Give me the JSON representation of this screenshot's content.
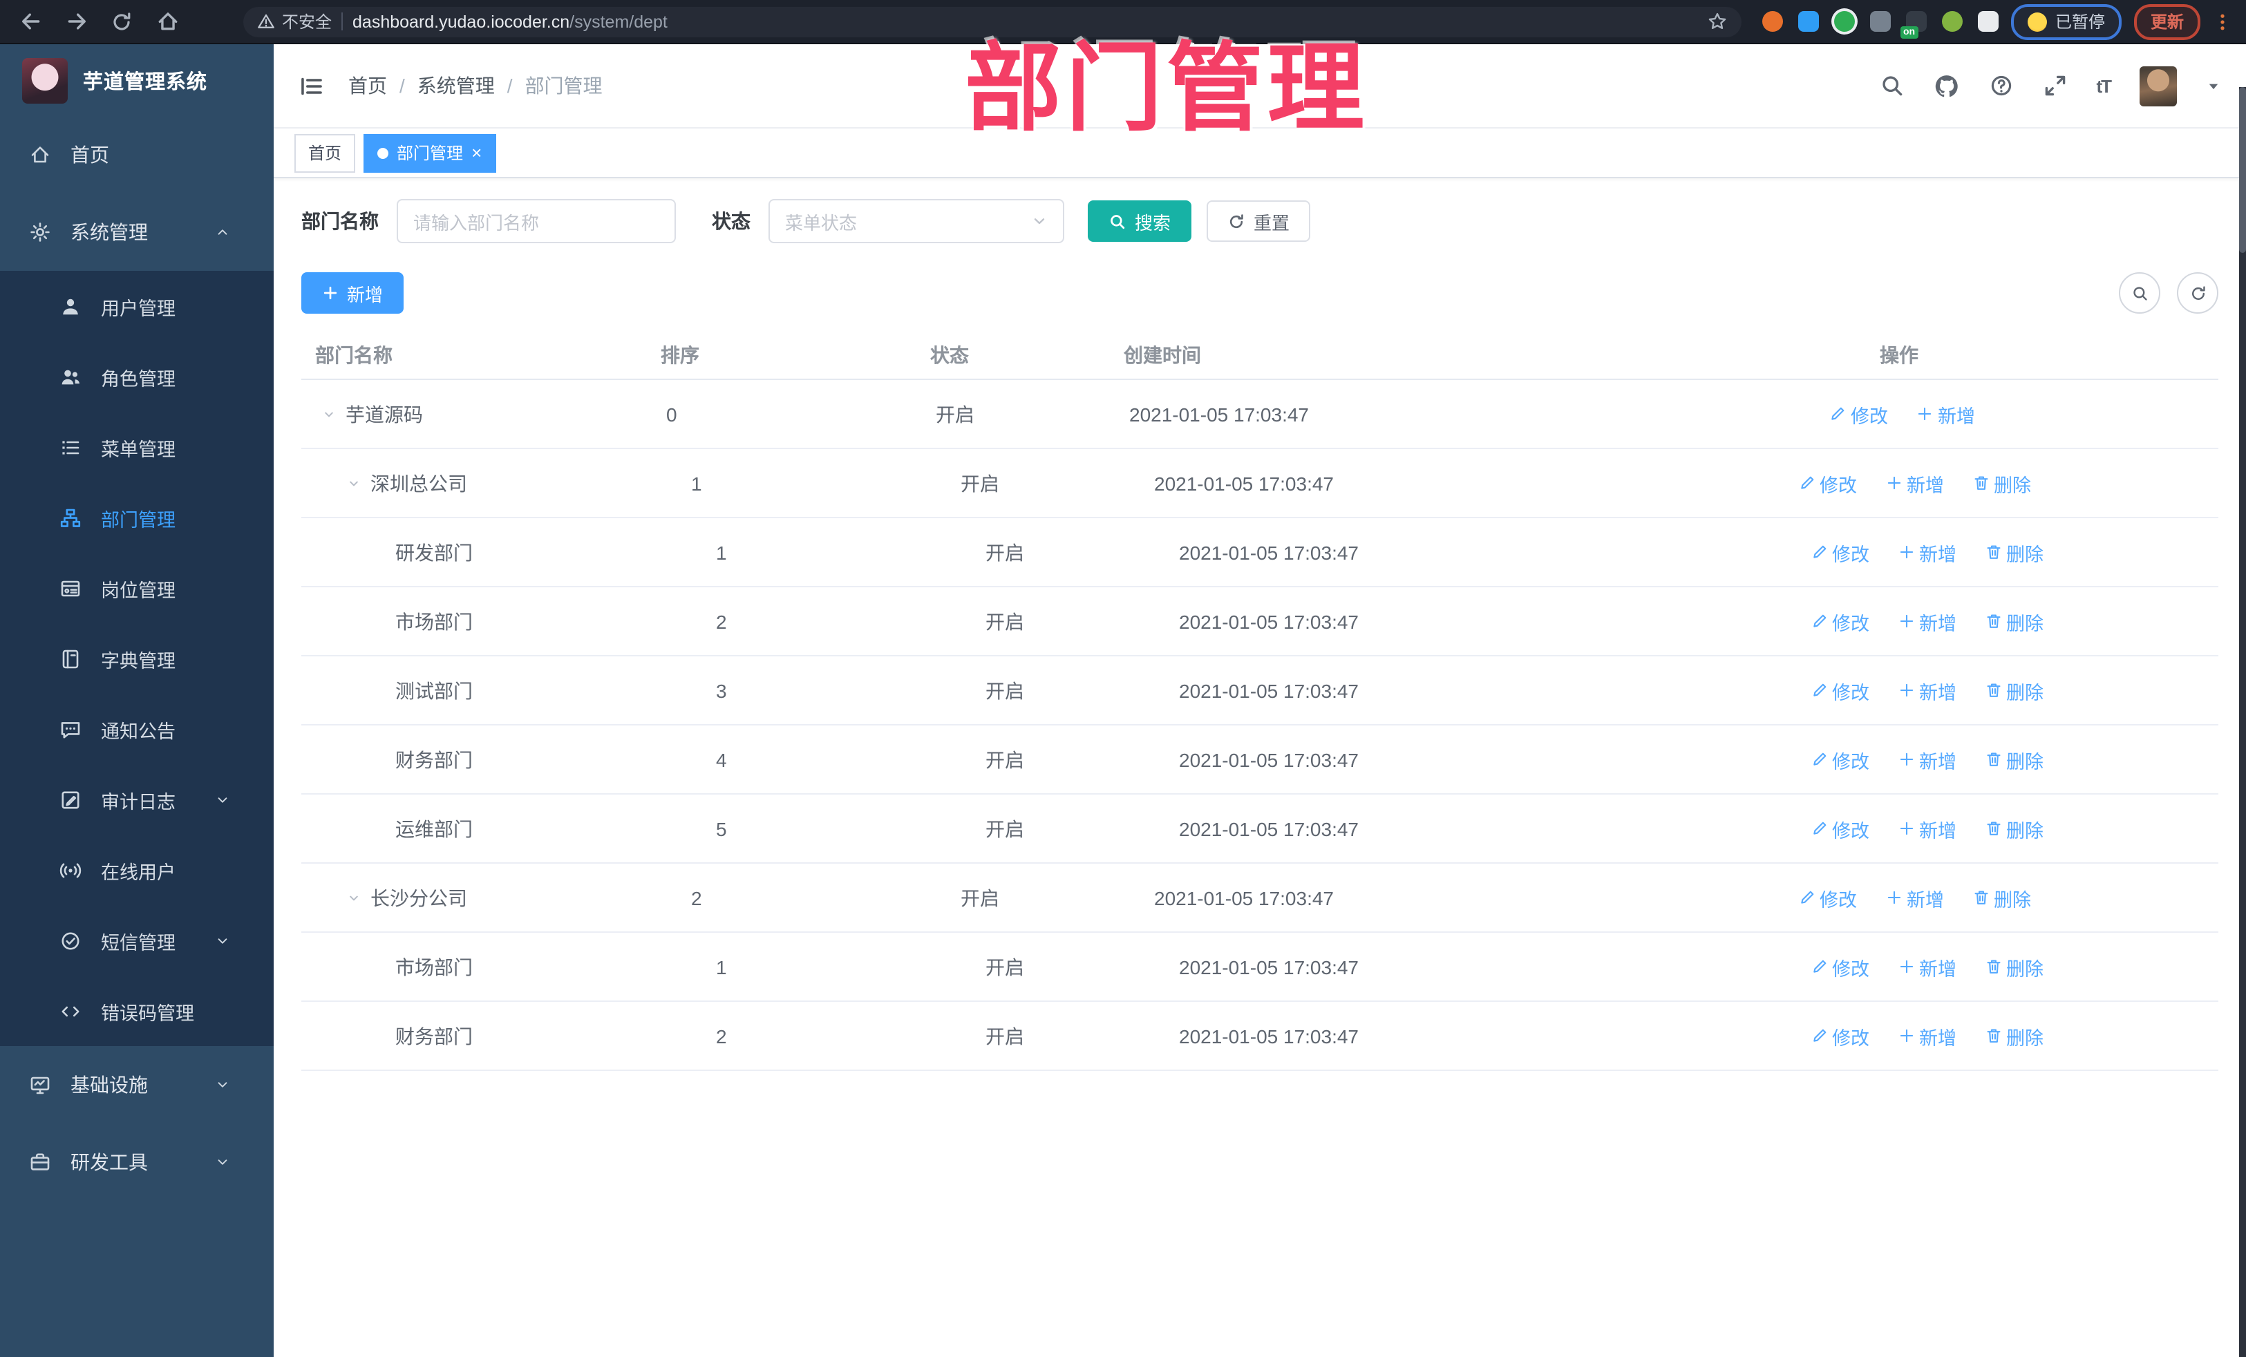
{
  "annotation": {
    "title": "部门管理",
    "color": "#f43f66"
  },
  "browser": {
    "security_label": "不安全",
    "url_host": "dashboard.yudao.iocoder.cn",
    "url_path": "/system/dept",
    "paused_label": "已暂停",
    "update_label": "更新",
    "extensions": [
      {
        "name": "extension-orange-icon",
        "color": "#e8702c",
        "shape": "circle"
      },
      {
        "name": "extension-location-icon",
        "color": "#2f9df4",
        "shape": "drop"
      },
      {
        "name": "extension-green-check-icon",
        "color": "#2fae54",
        "shape": "circle",
        "ring": "#e9ecef"
      },
      {
        "name": "extension-grid-icon",
        "color": "#77828f",
        "shape": "square"
      },
      {
        "name": "extension-adblock-icon",
        "color": "#343b45",
        "shape": "square",
        "badge": "on",
        "badge_color": "#23a455"
      },
      {
        "name": "extension-green-figure-icon",
        "color": "#83b441",
        "shape": "circle"
      },
      {
        "name": "extension-puzzle-icon",
        "color": "#e9ebee",
        "shape": "square"
      }
    ]
  },
  "sidebar": {
    "app_title": "芋道管理系统",
    "items": [
      {
        "label": "首页",
        "icon": "home-icon",
        "level": "top"
      },
      {
        "label": "系统管理",
        "icon": "gear-icon",
        "level": "top",
        "chevron": "up"
      },
      {
        "label": "用户管理",
        "icon": "user-icon",
        "level": "sub"
      },
      {
        "label": "角色管理",
        "icon": "users-icon",
        "level": "sub"
      },
      {
        "label": "菜单管理",
        "icon": "menu-list-icon",
        "level": "sub"
      },
      {
        "label": "部门管理",
        "icon": "org-tree-icon",
        "level": "sub",
        "active": true
      },
      {
        "label": "岗位管理",
        "icon": "id-badge-icon",
        "level": "sub"
      },
      {
        "label": "字典管理",
        "icon": "dictionary-icon",
        "level": "sub"
      },
      {
        "label": "通知公告",
        "icon": "announcement-icon",
        "level": "sub"
      },
      {
        "label": "审计日志",
        "icon": "audit-log-icon",
        "level": "sub",
        "chevron": "down"
      },
      {
        "label": "在线用户",
        "icon": "online-users-icon",
        "level": "sub"
      },
      {
        "label": "短信管理",
        "icon": "sms-icon",
        "level": "sub",
        "chevron": "down"
      },
      {
        "label": "错误码管理",
        "icon": "error-code-icon",
        "level": "sub"
      },
      {
        "label": "基础设施",
        "icon": "infrastructure-icon",
        "level": "top",
        "chevron": "down"
      },
      {
        "label": "研发工具",
        "icon": "dev-tools-icon",
        "level": "top",
        "chevron": "down"
      }
    ]
  },
  "navbar": {
    "breadcrumb": [
      "首页",
      "系统管理",
      "部门管理"
    ]
  },
  "tabs": [
    {
      "label": "首页",
      "active": false
    },
    {
      "label": "部门管理",
      "active": true,
      "closable": true
    }
  ],
  "filters": {
    "name_label": "部门名称",
    "name_placeholder": "请输入部门名称",
    "status_label": "状态",
    "status_placeholder": "菜单状态",
    "search_label": "搜索",
    "reset_label": "重置"
  },
  "toolbar": {
    "add_label": "新增"
  },
  "table": {
    "columns": [
      "部门名称",
      "排序",
      "状态",
      "创建时间",
      "操作"
    ],
    "action_labels": {
      "edit": "修改",
      "add": "新增",
      "delete": "删除"
    },
    "rows": [
      {
        "name": "芋道源码",
        "level": 0,
        "expandable": true,
        "sort": "0",
        "status": "开启",
        "created": "2021-01-05 17:03:47",
        "actions": [
          "edit",
          "add"
        ]
      },
      {
        "name": "深圳总公司",
        "level": 1,
        "expandable": true,
        "sort": "1",
        "status": "开启",
        "created": "2021-01-05 17:03:47",
        "actions": [
          "edit",
          "add",
          "delete"
        ]
      },
      {
        "name": "研发部门",
        "level": 2,
        "expandable": false,
        "sort": "1",
        "status": "开启",
        "created": "2021-01-05 17:03:47",
        "actions": [
          "edit",
          "add",
          "delete"
        ]
      },
      {
        "name": "市场部门",
        "level": 2,
        "expandable": false,
        "sort": "2",
        "status": "开启",
        "created": "2021-01-05 17:03:47",
        "actions": [
          "edit",
          "add",
          "delete"
        ]
      },
      {
        "name": "测试部门",
        "level": 2,
        "expandable": false,
        "sort": "3",
        "status": "开启",
        "created": "2021-01-05 17:03:47",
        "actions": [
          "edit",
          "add",
          "delete"
        ]
      },
      {
        "name": "财务部门",
        "level": 2,
        "expandable": false,
        "sort": "4",
        "status": "开启",
        "created": "2021-01-05 17:03:47",
        "actions": [
          "edit",
          "add",
          "delete"
        ]
      },
      {
        "name": "运维部门",
        "level": 2,
        "expandable": false,
        "sort": "5",
        "status": "开启",
        "created": "2021-01-05 17:03:47",
        "actions": [
          "edit",
          "add",
          "delete"
        ]
      },
      {
        "name": "长沙分公司",
        "level": 1,
        "expandable": true,
        "sort": "2",
        "status": "开启",
        "created": "2021-01-05 17:03:47",
        "actions": [
          "edit",
          "add",
          "delete"
        ]
      },
      {
        "name": "市场部门",
        "level": 2,
        "expandable": false,
        "sort": "1",
        "status": "开启",
        "created": "2021-01-05 17:03:47",
        "actions": [
          "edit",
          "add",
          "delete"
        ]
      },
      {
        "name": "财务部门",
        "level": 2,
        "expandable": false,
        "sort": "2",
        "status": "开启",
        "created": "2021-01-05 17:03:47",
        "actions": [
          "edit",
          "add",
          "delete"
        ]
      }
    ]
  },
  "colors": {
    "primary": "#409eff",
    "search_teal": "#17b2a5",
    "annotation_pink": "#f43f66",
    "sidebar_bg": "#2e4b66",
    "submenu_bg": "#1f344e",
    "action_link_blue": "#55a9ff"
  }
}
